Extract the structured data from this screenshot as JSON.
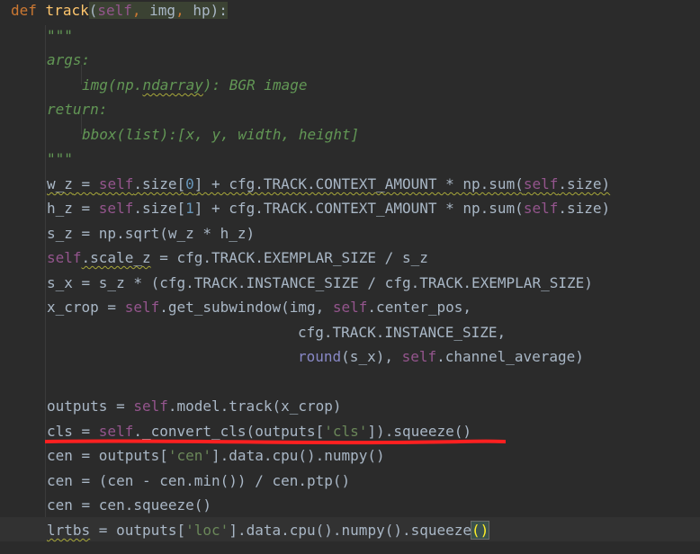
{
  "colors": {
    "background": "#2b2b2b",
    "keyword": "#cc7832",
    "function_name": "#ffc66d",
    "self": "#94558d",
    "docstring": "#629755",
    "number": "#6897bb",
    "string": "#6a8759",
    "plain": "#a9b7c6",
    "annotation_mark": "#ff2020"
  },
  "code": {
    "def_kw": "def",
    "func_name": "track",
    "p_open": "(",
    "p_self": "self",
    "p_sep1": ", ",
    "p_img": "img",
    "p_sep2": ", ",
    "p_hp": "hp",
    "p_close": "):",
    "doc_open": "\"\"\"",
    "doc_args": "args:",
    "doc_img_a": "img(np.",
    "doc_img_b": "ndarray",
    "doc_img_c": "): BGR image",
    "doc_return": "return:",
    "doc_bbox": "bbox(list):[x, y, width, height]",
    "doc_close": "\"\"\"",
    "wz_var": "w_z",
    "wz_a": " = ",
    "wz_self": "self",
    "wz_b": ".size[",
    "wz_num": "0",
    "wz_c": "] + cfg.TRACK.CONTEXT_AMOUNT * np.sum(",
    "wz_self2": "self",
    "wz_d": ".size)",
    "hz_a": "h_z = ",
    "hz_self": "self",
    "hz_b": ".size[",
    "hz_num": "1",
    "hz_c": "] + cfg.TRACK.CONTEXT_AMOUNT * np.sum(",
    "hz_self2": "self",
    "hz_d": ".size)",
    "sz": "s_z = np.sqrt(w_z * h_z)",
    "scale_self": "self",
    "scale_attr": ".scale_z",
    "scale_rest": " = cfg.TRACK.EXEMPLAR_SIZE / s_z",
    "sx": "s_x = s_z * (cfg.TRACK.INSTANCE_SIZE / cfg.TRACK.EXEMPLAR_SIZE)",
    "xc_a": "x_crop = ",
    "xc_self": "self",
    "xc_b": ".get_subwindow(img, ",
    "xc_self2": "self",
    "xc_c": ".center_pos,",
    "xc2": "cfg.TRACK.INSTANCE_SIZE,",
    "xc3_round": "round",
    "xc3_a": "(s_x), ",
    "xc3_self": "self",
    "xc3_b": ".channel_average)",
    "out_a": "outputs = ",
    "out_self": "self",
    "out_b": ".model.track(x_crop)",
    "cls_a": "cls = ",
    "cls_self": "self",
    "cls_b": "._convert_cls(outputs[",
    "cls_str": "'cls'",
    "cls_c": "]).squeeze()",
    "cen1_a": "cen = outputs[",
    "cen1_str": "'cen'",
    "cen1_b": "].data.cpu().numpy()",
    "cen2": "cen = (cen - cen.min()) / cen.ptp()",
    "cen3": "cen = cen.squeeze()",
    "lr_var": "lrtbs",
    "lr_a": " = outputs[",
    "lr_str": "'loc'",
    "lr_b": "].data.cpu().numpy().squeeze",
    "lr_paren": "()"
  }
}
